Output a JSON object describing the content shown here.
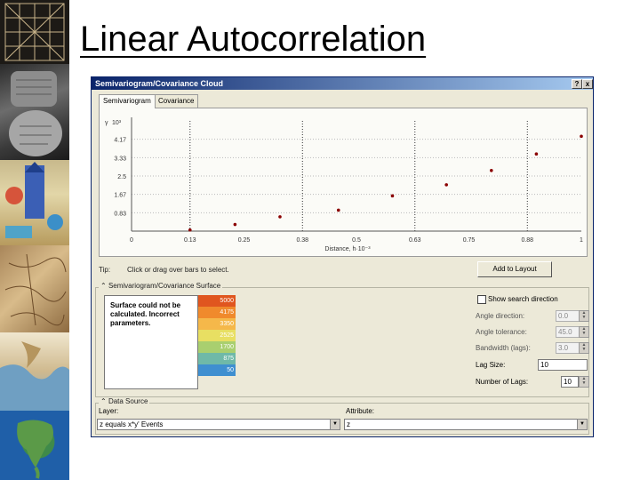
{
  "slide": {
    "title": "Linear Autocorrelation"
  },
  "strip": {
    "images": [
      "tablet-grid-image",
      "clay-tablet-image",
      "medieval-map-image",
      "stone-map-image",
      "mediterranean-map-image",
      "north-america-globe-image"
    ]
  },
  "window": {
    "title": "Semivariogram/Covariance Cloud",
    "buttons": [
      "?",
      "x"
    ],
    "tabs": [
      "Semivariogram",
      "Covariance"
    ],
    "tip_label": "Tip:",
    "tip_text": "Click or drag over bars to select.",
    "add_to_layout": "Add to Layout",
    "surface_group": "Semivariogram/Covariance Surface",
    "surface_message": "Surface could not be calculated. Incorrect parameters.",
    "legend": [
      {
        "label": "5000",
        "color": "#e0561f"
      },
      {
        "label": "4175",
        "color": "#f08a2c"
      },
      {
        "label": "3350",
        "color": "#f5b84a"
      },
      {
        "label": "2525",
        "color": "#e8df62"
      },
      {
        "label": "1700",
        "color": "#a9cf6f"
      },
      {
        "label": "875",
        "color": "#6fb9a8"
      },
      {
        "label": "50",
        "color": "#3f8fd0"
      }
    ],
    "show_search_direction": "Show search direction",
    "options": [
      {
        "label": "Angle direction:",
        "value": "0.0",
        "enabled": false
      },
      {
        "label": "Angle tolerance:",
        "value": "45.0",
        "enabled": false
      },
      {
        "label": "Bandwidth (lags):",
        "value": "3.0",
        "enabled": false
      }
    ],
    "lag_size_label": "Lag Size:",
    "lag_size_value": "10",
    "number_of_lags_label": "Number of Lags:",
    "number_of_lags_value": "10",
    "data_source_group": "Data Source",
    "layer_label": "Layer:",
    "layer_value": "z equals x*y' Events",
    "attribute_label": "Attribute:",
    "attribute_value": "z"
  },
  "chart_data": {
    "type": "scatter",
    "y_label": "γ",
    "y_exponent": "10³",
    "xlabel": "Distance, h·10⁻³",
    "x_ticks": [
      "0",
      "0.13",
      "0.25",
      "0.38",
      "0.5",
      "0.63",
      "0.75",
      "0.88",
      "1"
    ],
    "y_ticks": [
      "0.83",
      "1.67",
      "2.5",
      "3.33",
      "4.17"
    ],
    "xlim": [
      0,
      1
    ],
    "ylim": [
      0,
      5
    ],
    "grid": "dotted",
    "vlines": [
      0.13,
      0.38,
      0.63,
      0.88
    ],
    "points": [
      {
        "x": 0.13,
        "y": 0.05
      },
      {
        "x": 0.23,
        "y": 0.3
      },
      {
        "x": 0.33,
        "y": 0.65
      },
      {
        "x": 0.46,
        "y": 0.95
      },
      {
        "x": 0.58,
        "y": 1.6
      },
      {
        "x": 0.7,
        "y": 2.1
      },
      {
        "x": 0.8,
        "y": 2.75
      },
      {
        "x": 0.9,
        "y": 3.5
      },
      {
        "x": 1.0,
        "y": 4.3
      }
    ],
    "point_color": "#8b0000"
  }
}
